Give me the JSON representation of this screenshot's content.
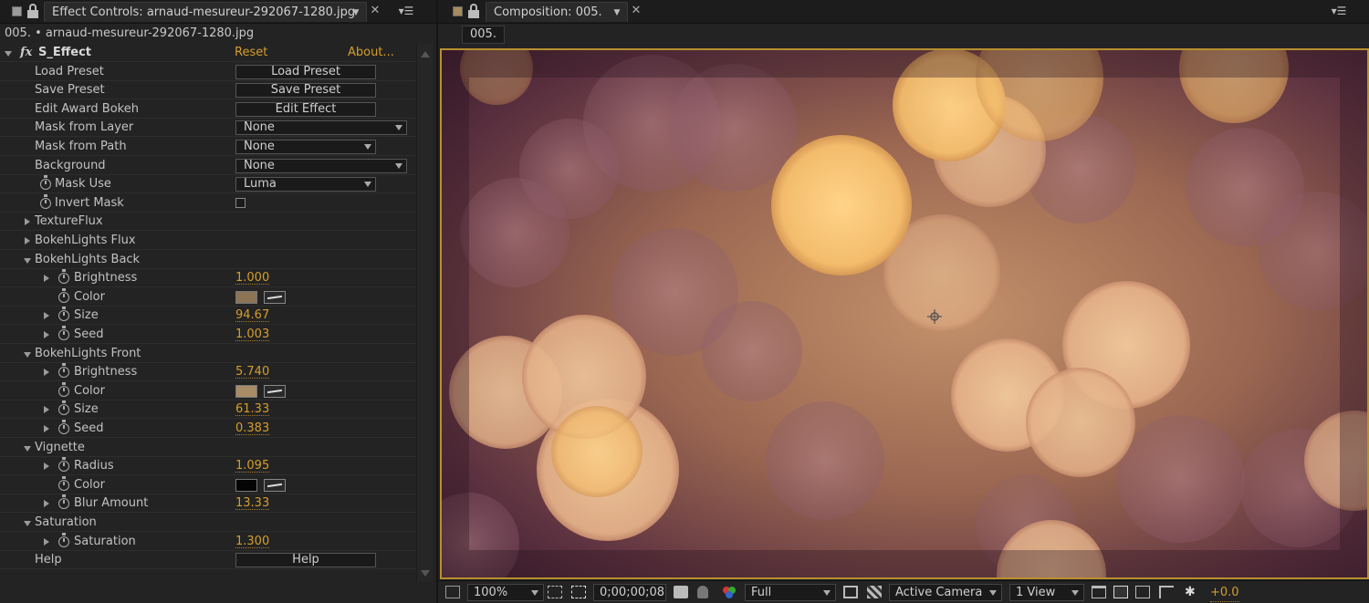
{
  "effect_controls": {
    "tab_title": "Effect Controls: arnaud-mesureur-292067-1280.jpg",
    "layer_line": "005. • arnaud-mesureur-292067-1280.jpg",
    "effect_name": "S_Effect",
    "fx_label": "fx",
    "reset_label": "Reset",
    "about_label": "About...",
    "rows": {
      "load_preset": {
        "label": "Load Preset",
        "button": "Load Preset"
      },
      "save_preset": {
        "label": "Save Preset",
        "button": "Save Preset"
      },
      "edit_award": {
        "label": "Edit Award Bokeh",
        "button": "Edit Effect"
      },
      "mask_from_layer": {
        "label": "Mask from Layer",
        "value": "None"
      },
      "mask_from_path": {
        "label": "Mask from Path",
        "value": "None"
      },
      "background": {
        "label": "Background",
        "value": "None"
      },
      "mask_use": {
        "label": "Mask Use",
        "value": "Luma"
      },
      "invert_mask": {
        "label": "Invert Mask"
      },
      "textureflux": {
        "label": "TextureFlux"
      },
      "bokehlights_flux": {
        "label": "BokehLights Flux"
      },
      "bokehlights_back": {
        "label": "BokehLights Back"
      },
      "back_brightness": {
        "label": "Brightness",
        "value": "1.000"
      },
      "back_color": {
        "label": "Color",
        "color": "#8c7457"
      },
      "back_size": {
        "label": "Size",
        "value": "94.67"
      },
      "back_seed": {
        "label": "Seed",
        "value": "1.003"
      },
      "bokehlights_front": {
        "label": "BokehLights Front"
      },
      "front_brightness": {
        "label": "Brightness",
        "value": "5.740"
      },
      "front_color": {
        "label": "Color",
        "color": "#a98c66"
      },
      "front_size": {
        "label": "Size",
        "value": "61.33"
      },
      "front_seed": {
        "label": "Seed",
        "value": "0.383"
      },
      "vignette": {
        "label": "Vignette"
      },
      "vig_radius": {
        "label": "Radius",
        "value": "1.095"
      },
      "vig_color": {
        "label": "Color",
        "color": "#050505"
      },
      "vig_blur": {
        "label": "Blur Amount",
        "value": "13.33"
      },
      "saturation_group": {
        "label": "Saturation"
      },
      "saturation": {
        "label": "Saturation",
        "value": "1.300"
      },
      "help": {
        "label": "Help",
        "button": "Help"
      }
    }
  },
  "composition": {
    "tab_title": "Composition: 005.",
    "crumb": "005.",
    "footer": {
      "zoom": "100%",
      "timecode": "0;00;00;08",
      "resolution": "Full",
      "camera": "Active Camera",
      "views": "1 View",
      "exposure": "+0.0"
    }
  },
  "colors": {
    "accent_orange": "#d59e2e",
    "panel_bg": "#232323",
    "viewer_border": "#b88f2f"
  }
}
